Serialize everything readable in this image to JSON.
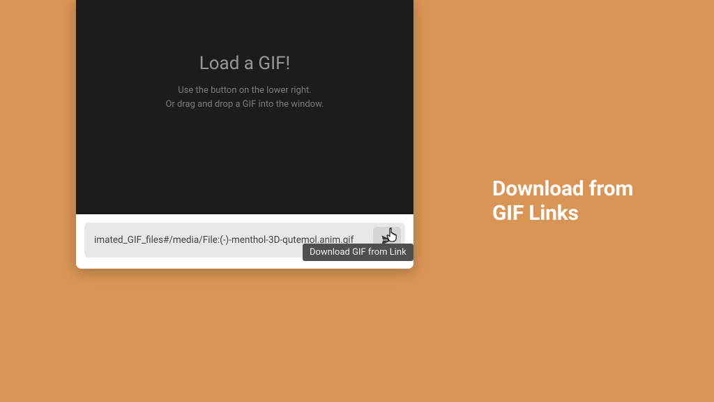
{
  "headline": {
    "line1": "Download from",
    "line2": "GIF Links"
  },
  "dropzone": {
    "title": "Load a GIF!",
    "hint1": "Use the button on the lower right.",
    "hint2": "Or drag and drop a GIF into the window."
  },
  "url_input": {
    "value": "imated_GIF_files#/media/File:(-)-menthol-3D-qutemol.anim.gif"
  },
  "tooltip": "Download GIF from Link"
}
